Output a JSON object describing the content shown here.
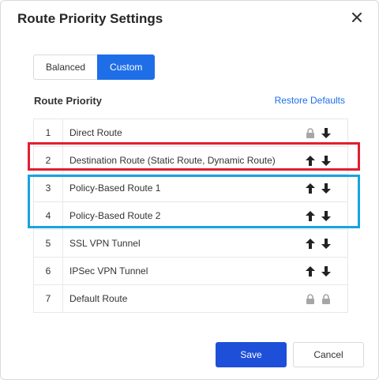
{
  "dialog": {
    "title": "Route Priority Settings",
    "close_icon": "close-icon"
  },
  "mode": {
    "options": [
      "Balanced",
      "Custom"
    ],
    "selected": "Custom"
  },
  "section": {
    "title": "Route Priority",
    "restore_label": "Restore Defaults"
  },
  "routes": [
    {
      "num": "1",
      "name": "Direct Route",
      "up": "lock-icon",
      "down": "arrow-down-icon"
    },
    {
      "num": "2",
      "name": "Destination Route (Static Route, Dynamic Route)",
      "up": "arrow-up-icon",
      "down": "arrow-down-icon"
    },
    {
      "num": "3",
      "name": "Policy-Based Route 1",
      "up": "arrow-up-icon",
      "down": "arrow-down-icon"
    },
    {
      "num": "4",
      "name": "Policy-Based Route 2",
      "up": "arrow-up-icon",
      "down": "arrow-down-icon"
    },
    {
      "num": "5",
      "name": "SSL VPN Tunnel",
      "up": "arrow-up-icon",
      "down": "arrow-down-icon"
    },
    {
      "num": "6",
      "name": "IPSec VPN Tunnel",
      "up": "arrow-up-icon",
      "down": "arrow-down-icon"
    },
    {
      "num": "7",
      "name": "Default Route",
      "up": "lock-icon",
      "down": "lock-icon"
    }
  ],
  "footer": {
    "save_label": "Save",
    "cancel_label": "Cancel"
  },
  "colors": {
    "primary": "#1e6ee8",
    "save": "#1e4fd8",
    "highlight_red": "#e02030",
    "highlight_blue": "#18a3e0"
  }
}
